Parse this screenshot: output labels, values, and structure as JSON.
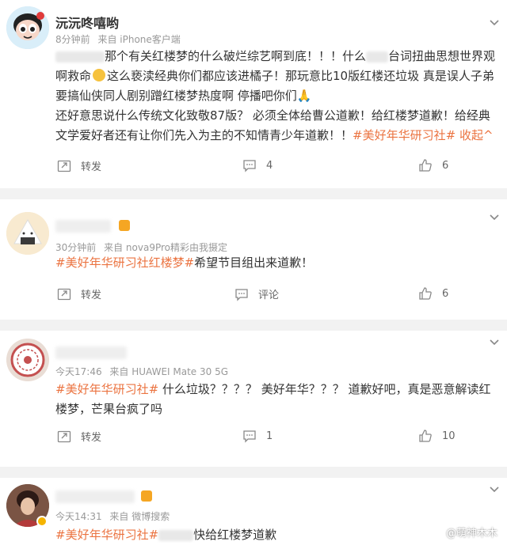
{
  "posts": [
    {
      "username": "沅沅咚嘻哟",
      "time": "8分钟前",
      "source": "来自 iPhone客户端",
      "text1": "那个有关红楼梦的什么破烂综艺啊到底！！！什么",
      "text2": "台词扭曲思想世界观",
      "text3": "啊救命",
      "text4": "这么亵渎经典你们都应该进橘子！那玩意比10版红楼还垃圾 真是误人子弟 要搞仙侠同人剧别蹭红楼梦热度啊 停播吧你们",
      "text5": "还好意思说什么传统文化致敬87版？ 必须全体给曹公道歉！给红楼梦道歉！给经典文学爱好者还有让你们先入为主的不知情青少年道歉！！",
      "tag": "#美好年华研习社#",
      "collapse": "收起",
      "repost": "转发",
      "comments": "4",
      "likes": "6"
    },
    {
      "time": "30分钟前",
      "source": "来自 nova9Pro精彩由我摄定",
      "tag1": "#美好年华研习社红楼梦#",
      "text": "希望节目组出来道歉！",
      "repost": "转发",
      "comments": "评论",
      "likes": "6"
    },
    {
      "time": "今天17:46",
      "source": "来自 HUAWEI Mate 30 5G",
      "tag": "#美好年华研习社#",
      "text": "什么垃圾？？？？ 美好年华？？？ 道歉好吧，真是恶意解读红楼梦，芒果台疯了吗",
      "repost": "转发",
      "comments": "1",
      "likes": "10"
    },
    {
      "time": "今天14:31",
      "source": "来自 微博搜索",
      "tag": "#美好年华研习社#",
      "text": "快给红楼梦道歉"
    }
  ],
  "watermark": "@萌神木木",
  "colors": {
    "accent": "#eb7340",
    "separator": "#f2f2f2",
    "meta": "#999999"
  }
}
